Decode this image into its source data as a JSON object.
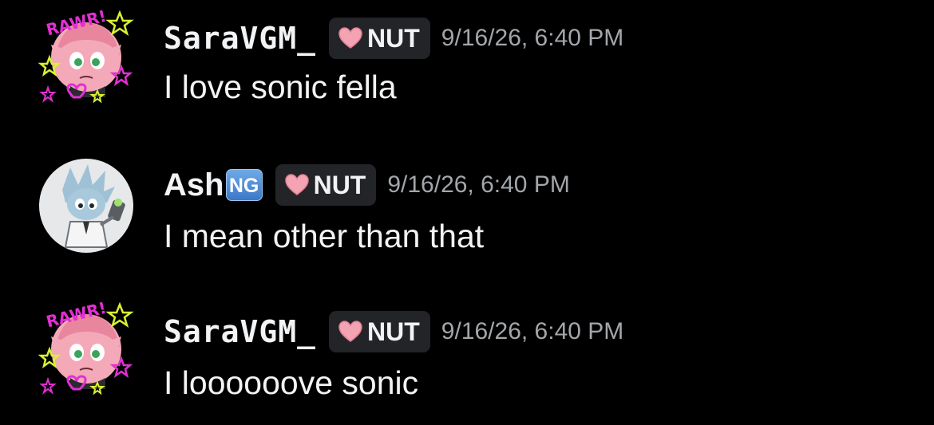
{
  "messages": [
    {
      "username": "SaraVGM_",
      "username_badge": "",
      "tag": "NUT",
      "timestamp": "9/16/26, 6:40 PM",
      "content": "I love sonic fella",
      "avatar_text": "RAWR!"
    },
    {
      "username": "Ash",
      "username_badge": "NG",
      "tag": "NUT",
      "timestamp": "9/16/26, 6:40 PM",
      "content": "I mean other than that"
    },
    {
      "username": "SaraVGM_",
      "username_badge": "",
      "tag": "NUT",
      "timestamp": "9/16/26, 6:40 PM",
      "content": "I loooooove sonic",
      "avatar_text": "RAWR!"
    }
  ],
  "colors": {
    "background": "#000000",
    "text": "#f2f3f5",
    "timestamp": "#a3a6aa",
    "tag_background": "#232428",
    "heart": "#f4a3b3",
    "ng_badge": "#4a86d4"
  },
  "icons": {
    "tag_icon": "pink-heart-icon",
    "badge_icon": "ng-button-emoji"
  }
}
